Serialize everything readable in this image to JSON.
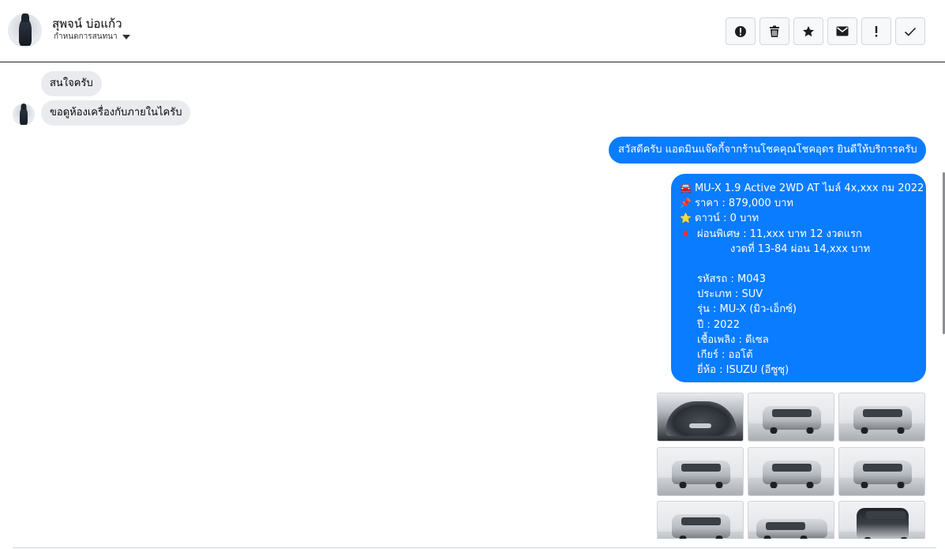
{
  "header": {
    "contact_name": "สุพจน์ บ่อแก้ว",
    "sub_label": "กำหนดการสนทนา",
    "toolbar": [
      {
        "name": "mark-spam-button",
        "icon": "alert-circle-icon"
      },
      {
        "name": "delete-button",
        "icon": "trash-icon"
      },
      {
        "name": "star-button",
        "icon": "star-icon"
      },
      {
        "name": "mark-unread-button",
        "icon": "envelope-icon"
      },
      {
        "name": "important-button",
        "icon": "exclamation-icon"
      },
      {
        "name": "mark-done-button",
        "icon": "check-icon"
      }
    ]
  },
  "messages": {
    "incoming_1": "สนใจครับ",
    "incoming_2": "ขอดูห้องเครื่องกับภายในไครับ",
    "outgoing_1": "สวัสดีครับ แอดมินแจ๊คกี้จากร้านโชคคุณโชคอุดร ยินดีให้บริการครับ"
  },
  "car_card": {
    "title": "MU-X 1.9 Active 2WD AT ไมล์ 4x,xxx กม 2022",
    "price": "ราคา : 879,000 บาท",
    "down": "ดาวน์ : 0 บาท",
    "installment_1": "ผ่อนพิเศษ : 11,xxx บาท 12 งวดแรก",
    "installment_2": "งวดที่ 13-84 ผ่อน 14,xxx บาท",
    "code": "รหัสรถ : M043",
    "type": "ประเภท : SUV",
    "model": "รุ่น : MU-X (มิว-เอ็กซ์)",
    "year": "ปี : 2022",
    "fuel": "เชื้อเพลิง : ดีเซล",
    "gear": "เกียร์ : ออโต้",
    "brand": "ยี่ห้อ : ISUZU (อีซูซุ)",
    "icons": {
      "title": "car-icon",
      "price": "pin-icon",
      "down": "star-icon",
      "installment": "red-diamond-icon"
    }
  },
  "gallery": {
    "images": [
      {
        "name": "photo-engine-bay"
      },
      {
        "name": "photo-front-left"
      },
      {
        "name": "photo-front"
      },
      {
        "name": "photo-front-right"
      },
      {
        "name": "photo-rear-left"
      },
      {
        "name": "photo-rear"
      },
      {
        "name": "photo-rear-right"
      },
      {
        "name": "photo-side"
      },
      {
        "name": "photo-open-tailgate"
      }
    ]
  },
  "colors": {
    "accent": "#0a7cff",
    "incoming_bg": "#e9ebee"
  }
}
